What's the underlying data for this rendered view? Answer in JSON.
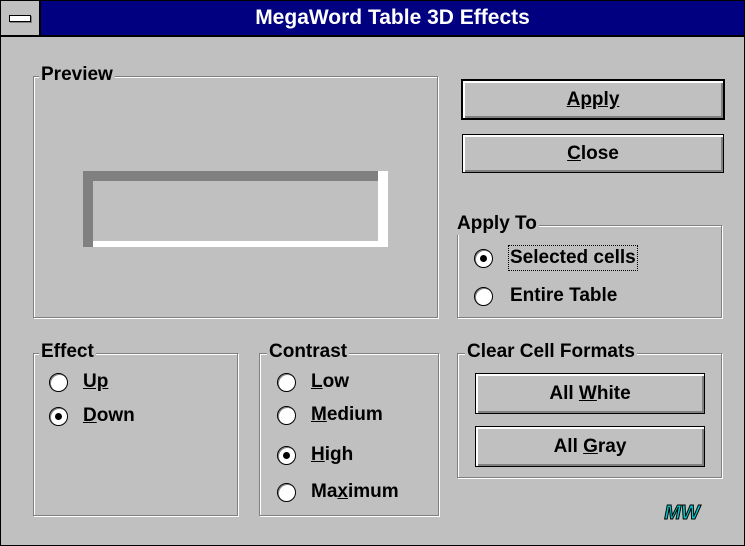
{
  "window": {
    "title": "MegaWord Table 3D Effects"
  },
  "preview": {
    "legend": "Preview"
  },
  "buttons": {
    "apply": "Apply",
    "close": "Close"
  },
  "apply_to": {
    "legend": "Apply To",
    "options": [
      "Selected cells",
      "Entire Table"
    ],
    "selected": "Selected cells"
  },
  "effect": {
    "legend": "Effect",
    "options": [
      "Up",
      "Down"
    ],
    "selected": "Down"
  },
  "contrast": {
    "legend": "Contrast",
    "options": [
      "Low",
      "Medium",
      "High",
      "Maximum"
    ],
    "selected": "High"
  },
  "clear_cell_formats": {
    "legend": "Clear Cell Formats",
    "all_white": "All White",
    "all_gray": "All Gray"
  },
  "logo": {
    "text": "MW",
    "icon": "megaword-logo"
  },
  "colors": {
    "title_bar": "#000080",
    "face": "#c0c0c0",
    "shadow": "#808080",
    "highlight": "#ffffff",
    "logo_fill": "#00c8c8"
  }
}
